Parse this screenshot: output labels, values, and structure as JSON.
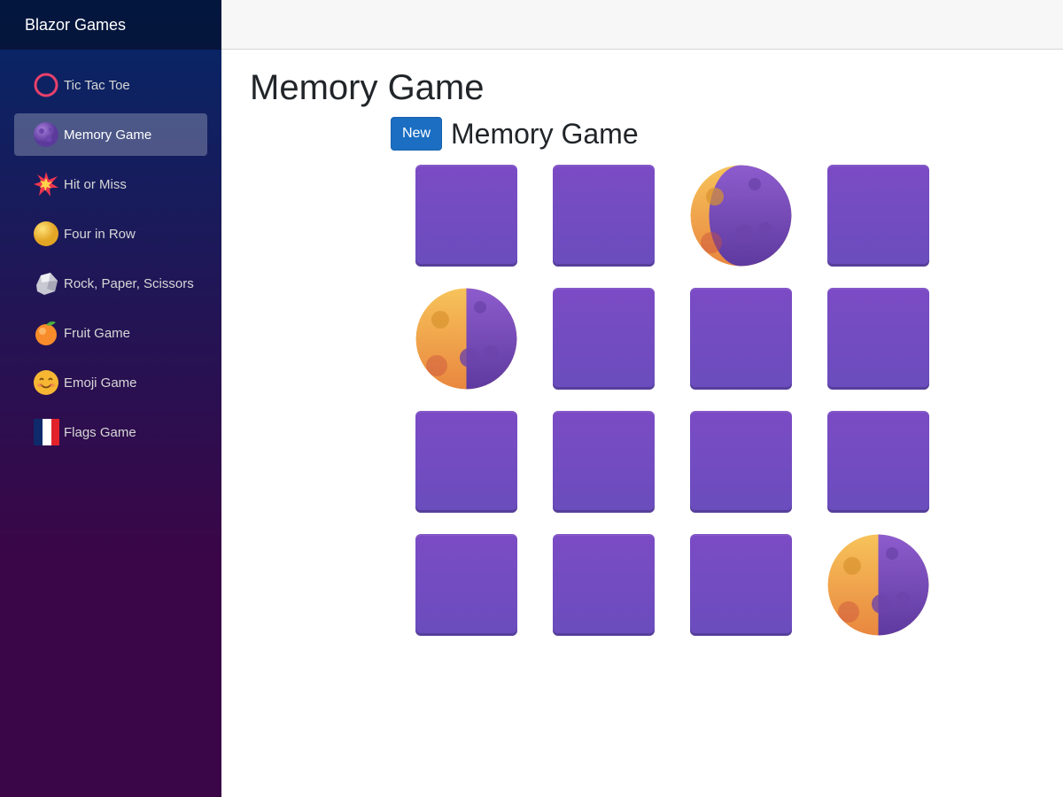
{
  "brand": "Blazor Games",
  "nav": [
    {
      "label": "Tic Tac Toe",
      "icon": "ring-icon",
      "active": false
    },
    {
      "label": "Memory Game",
      "icon": "purple-moon-icon",
      "active": true
    },
    {
      "label": "Hit or Miss",
      "icon": "collision-icon",
      "active": false
    },
    {
      "label": "Four in Row",
      "icon": "yellow-circle-icon",
      "active": false
    },
    {
      "label": "Rock, Paper, Scissors",
      "icon": "rock-icon",
      "active": false
    },
    {
      "label": "Fruit Game",
      "icon": "tangerine-icon",
      "active": false
    },
    {
      "label": "Emoji Game",
      "icon": "smiling-face-icon",
      "active": false
    },
    {
      "label": "Flags Game",
      "icon": "france-flag-icon",
      "active": false
    }
  ],
  "page_title": "Memory Game",
  "game": {
    "new_button": "New",
    "title": "Memory Game"
  },
  "board": {
    "columns": 4,
    "cards": [
      {
        "state": "hidden"
      },
      {
        "state": "hidden"
      },
      {
        "state": "revealed",
        "face": "waxing-crescent-moon"
      },
      {
        "state": "hidden"
      },
      {
        "state": "revealed",
        "face": "first-quarter-moon"
      },
      {
        "state": "hidden"
      },
      {
        "state": "hidden"
      },
      {
        "state": "hidden"
      },
      {
        "state": "hidden"
      },
      {
        "state": "hidden"
      },
      {
        "state": "hidden"
      },
      {
        "state": "hidden"
      },
      {
        "state": "hidden"
      },
      {
        "state": "hidden"
      },
      {
        "state": "hidden"
      },
      {
        "state": "revealed",
        "face": "first-quarter-moon"
      }
    ]
  },
  "colors": {
    "card_back": "#7148c2",
    "button": "#1b6ec2",
    "moon_purple": "#7d50c0",
    "moon_yellow": "#f2b24a"
  }
}
